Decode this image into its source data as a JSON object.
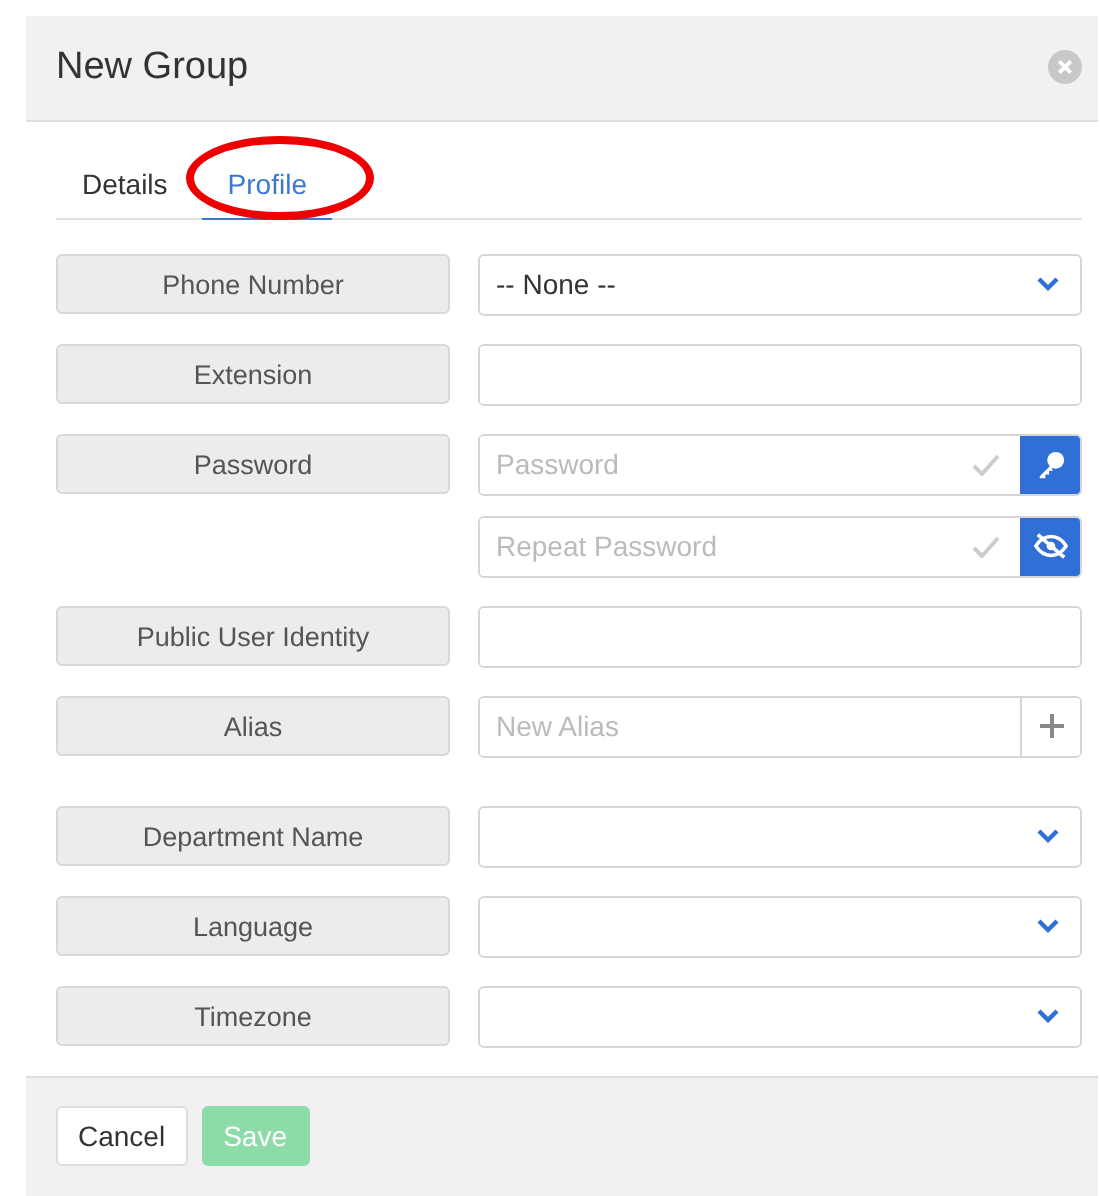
{
  "dialog": {
    "title": "New Group"
  },
  "tabs": [
    {
      "label": "Details",
      "selected": false,
      "circled": false
    },
    {
      "label": "Profile",
      "selected": true,
      "circled": true
    }
  ],
  "rows": [
    {
      "kind": "select",
      "label": "Phone Number",
      "value": "-- None --"
    },
    {
      "kind": "text",
      "label": "Extension"
    },
    {
      "kind": "secret",
      "label": "Password",
      "placeholder": "Password",
      "button": {
        "kind": "key"
      }
    },
    {
      "kind": "secret",
      "placeholder": "Repeat Password",
      "button": {
        "kind": "eye"
      }
    },
    {
      "kind": "text",
      "label": "Public User Identity"
    },
    {
      "kind": "add",
      "label": "Alias",
      "placeholder": "New Alias"
    },
    {
      "kind": "select",
      "label": "Department Name"
    },
    {
      "kind": "select",
      "label": "Language"
    },
    {
      "kind": "select",
      "label": "Timezone"
    }
  ],
  "buttons": [
    {
      "label": "Cancel",
      "kind": "secondary"
    },
    {
      "label": "Save",
      "kind": "primary",
      "disabled": true
    }
  ]
}
